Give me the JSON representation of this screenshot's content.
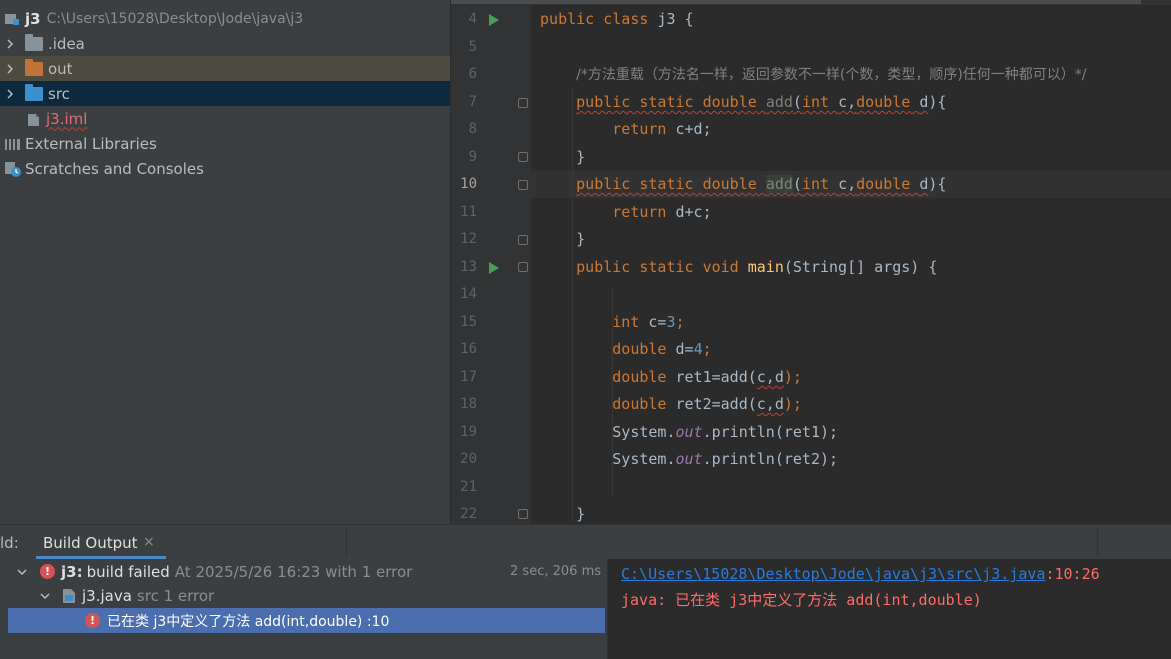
{
  "project": {
    "root_name": "j3",
    "root_path": "C:\\Users\\15028\\Desktop\\Jode\\java\\j3",
    "items": [
      {
        "label": ".idea",
        "icon": "folder-icon",
        "color": "#87939a"
      },
      {
        "label": "out",
        "icon": "folder-orange-icon",
        "color": "#c1733a"
      },
      {
        "label": "src",
        "icon": "folder-blue-icon",
        "color": "#3d8fcb"
      },
      {
        "label": "j3.iml",
        "icon": "iml-file-icon",
        "color": "#e06c6c"
      },
      {
        "label": "External Libraries",
        "icon": "library-icon"
      },
      {
        "label": "Scratches and Consoles",
        "icon": "scratches-icon"
      }
    ]
  },
  "editor": {
    "current_line": "10",
    "lines": [
      {
        "num": "4"
      },
      {
        "num": "5"
      },
      {
        "num": "6"
      },
      {
        "num": "7"
      },
      {
        "num": "8"
      },
      {
        "num": "9"
      },
      {
        "num": "10"
      },
      {
        "num": "11"
      },
      {
        "num": "12"
      },
      {
        "num": "13"
      },
      {
        "num": "14"
      },
      {
        "num": "15"
      },
      {
        "num": "16"
      },
      {
        "num": "17"
      },
      {
        "num": "18"
      },
      {
        "num": "19"
      },
      {
        "num": "20"
      },
      {
        "num": "21"
      },
      {
        "num": "22"
      }
    ],
    "tokens": {
      "l4_public": "public",
      "l4_class": "class",
      "l4_name": "j3",
      "l4_brace": "{",
      "l6_comment": "/*方法重载（方法名一样，返回参数不一样(个数，类型，顺序)任何一种都可以）*/",
      "l7_mods": "public static double",
      "l7_fn": "add",
      "l7_paren": "(",
      "l7_int": "int",
      "l7_c": "c,",
      "l7_double": "double",
      "l7_d": "d",
      "l7_close": "){",
      "l8_return": "return",
      "l8_expr": "c+d;",
      "l9_brace": "}",
      "l10_mods": "public static double",
      "l10_fn": "add",
      "l10_paren": "(",
      "l10_int": "int",
      "l10_c": "c,",
      "l10_double": "double",
      "l10_d": "d",
      "l10_close": "){",
      "l11_return": "return",
      "l11_expr": "d+c;",
      "l12_brace": "}",
      "l13_mods": "public static void",
      "l13_fn": "main",
      "l13_args": "(String[] args) {",
      "l15_int": "int",
      "l15_a": "c=",
      "l15_n": "3",
      "l15_b": ";",
      "l16_double": "double",
      "l16_a": "d=",
      "l16_n": "4",
      "l16_b": ";",
      "l17_double": "double",
      "l17_a": "ret1=add(",
      "l17_args": "c,d",
      "l17_b": ");",
      "l18_double": "double",
      "l18_a": "ret2=add(",
      "l18_args": "c,d",
      "l18_b": ");",
      "l19_a": "System.",
      "l19_out": "out",
      "l19_b": ".println(ret1);",
      "l20_a": "System.",
      "l20_out": "out",
      "l20_b": ".println(ret2);",
      "l22_brace": "}"
    }
  },
  "bottom": {
    "title": "ld:",
    "tab_label": "Build Output",
    "tab_close": "×",
    "build": {
      "root_name": "j3:",
      "root_status": "build failed",
      "root_detail": "At 2025/5/26 16:23 with 1 error",
      "time": "2 sec, 206 ms",
      "file_name": "j3.java",
      "file_detail": "src 1 error",
      "error_message": "已在类 j3中定义了方法 add(int,double) :10"
    },
    "output": {
      "path_link": "C:\\Users\\15028\\Desktop\\Jode\\java\\j3\\src\\j3.java",
      "path_suffix": ":10:26",
      "error_line": "java: 已在类 j3中定义了方法 add(int,double)"
    }
  }
}
